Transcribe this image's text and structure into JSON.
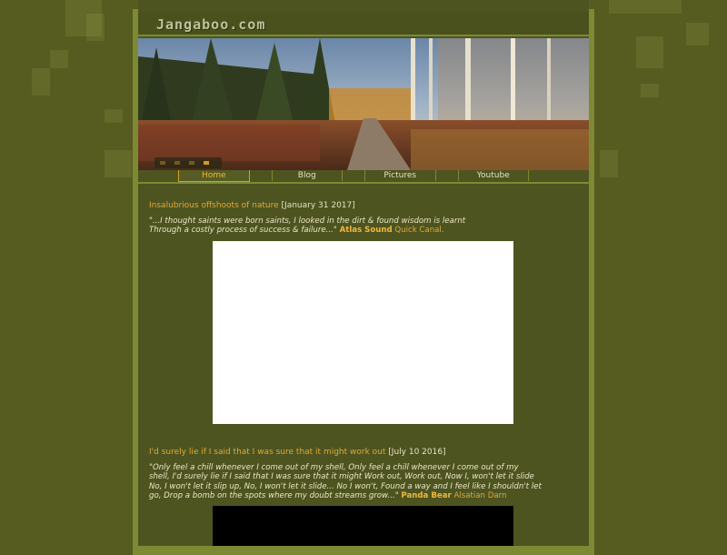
{
  "site": {
    "logo": "Jangaboo.com"
  },
  "banner": {
    "slides": [
      "slide-1",
      "slide-2",
      "slide-3",
      "slide-4"
    ],
    "active_slide": 4
  },
  "nav": {
    "items": [
      {
        "label": "Home",
        "active": true
      },
      {
        "label": "Blog",
        "active": false
      },
      {
        "label": "Pictures",
        "active": false
      },
      {
        "label": "Youtube",
        "active": false
      }
    ]
  },
  "posts": [
    {
      "title": "Insalubrious offshoots of nature",
      "date": "[January 31 2017]",
      "quote_line1": "\"...I thought saints were born saints, I looked in the dirt & found wisdom is learnt",
      "quote_line2": "Through a costly process of success & failure...\"",
      "artist": "Atlas Sound",
      "song": "Quick Canal.",
      "video_color": "#ffffff"
    },
    {
      "title": "I'd surely lie if I said that I was sure that it might work out",
      "date": "[July 10 2016]",
      "quote_line1": "\"Only feel a chill whenever I come out of my shell, Only feel a chill whenever I come out of my",
      "quote_line2": "shell, I'd surely lie if I said that I was sure that it might Work out, Work out, Now I, won't let it slide",
      "quote_line3": "No, I won't let it slip up, No, I won't let it slide... No I won't, Found a way and I feel like I shouldn't let",
      "quote_line4": "go, Drop a bomb on the spots where my doubt streams grow...\"",
      "artist": "Panda Bear",
      "song": "Alsatian Darn",
      "video_color": "#000000"
    }
  ]
}
